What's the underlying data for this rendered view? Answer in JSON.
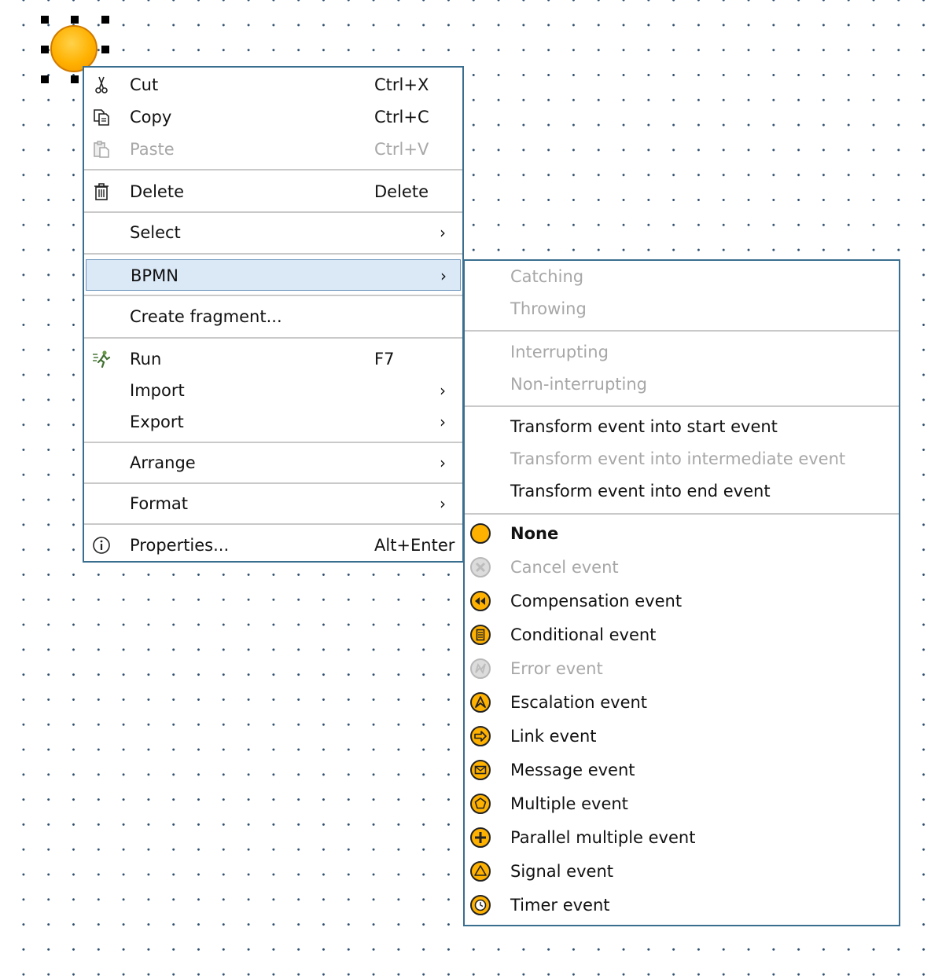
{
  "context_menu": {
    "items": [
      {
        "label": "Cut",
        "shortcut": "Ctrl+X",
        "icon": "scissors-icon",
        "enabled": true
      },
      {
        "label": "Copy",
        "shortcut": "Ctrl+C",
        "icon": "copy-icon",
        "enabled": true
      },
      {
        "label": "Paste",
        "shortcut": "Ctrl+V",
        "icon": "paste-icon",
        "enabled": false
      },
      {
        "label": "Delete",
        "shortcut": "Delete",
        "icon": "trash-icon",
        "enabled": true
      },
      {
        "label": "Select",
        "submenu": true,
        "enabled": true
      },
      {
        "label": "BPMN",
        "submenu": true,
        "enabled": true,
        "highlighted": true
      },
      {
        "label": "Create fragment...",
        "enabled": true
      },
      {
        "label": "Run",
        "shortcut": "F7",
        "icon": "run-icon",
        "enabled": true
      },
      {
        "label": "Import",
        "submenu": true,
        "enabled": true
      },
      {
        "label": "Export",
        "submenu": true,
        "enabled": true
      },
      {
        "label": "Arrange",
        "submenu": true,
        "enabled": true
      },
      {
        "label": "Format",
        "submenu": true,
        "enabled": true
      },
      {
        "label": "Properties...",
        "shortcut": "Alt+Enter",
        "icon": "info-icon",
        "enabled": true
      }
    ],
    "submenu_arrow": "›"
  },
  "bpmn_submenu": {
    "mode_items": [
      {
        "label": "Catching",
        "enabled": false
      },
      {
        "label": "Throwing",
        "enabled": false
      }
    ],
    "interrupt_items": [
      {
        "label": "Interrupting",
        "enabled": false
      },
      {
        "label": "Non-interrupting",
        "enabled": false
      }
    ],
    "transform_items": [
      {
        "label": "Transform event into start event",
        "enabled": true
      },
      {
        "label": "Transform event into intermediate event",
        "enabled": false
      },
      {
        "label": "Transform event into end event",
        "enabled": true
      }
    ],
    "event_types": [
      {
        "label": "None",
        "icon": "none-event-icon",
        "enabled": true,
        "selected": true
      },
      {
        "label": "Cancel event",
        "icon": "cancel-event-icon",
        "enabled": false
      },
      {
        "label": "Compensation event",
        "icon": "compensation-event-icon",
        "enabled": true
      },
      {
        "label": "Conditional event",
        "icon": "conditional-event-icon",
        "enabled": true
      },
      {
        "label": "Error event",
        "icon": "error-event-icon",
        "enabled": false
      },
      {
        "label": "Escalation event",
        "icon": "escalation-event-icon",
        "enabled": true
      },
      {
        "label": "Link event",
        "icon": "link-event-icon",
        "enabled": true
      },
      {
        "label": "Message event",
        "icon": "message-event-icon",
        "enabled": true
      },
      {
        "label": "Multiple event",
        "icon": "multiple-event-icon",
        "enabled": true
      },
      {
        "label": "Parallel multiple event",
        "icon": "parallel-multiple-event-icon",
        "enabled": true
      },
      {
        "label": "Signal event",
        "icon": "signal-event-icon",
        "enabled": true
      },
      {
        "label": "Timer event",
        "icon": "timer-event-icon",
        "enabled": true
      }
    ]
  },
  "colors": {
    "menu_border": "#3a6e8f",
    "highlight_bg": "#dbe8f6",
    "disabled_text": "#a7a7a7",
    "event_fill": "#ffb100",
    "event_stroke": "#d07a00",
    "grid_dot": "#2f4f6f"
  }
}
